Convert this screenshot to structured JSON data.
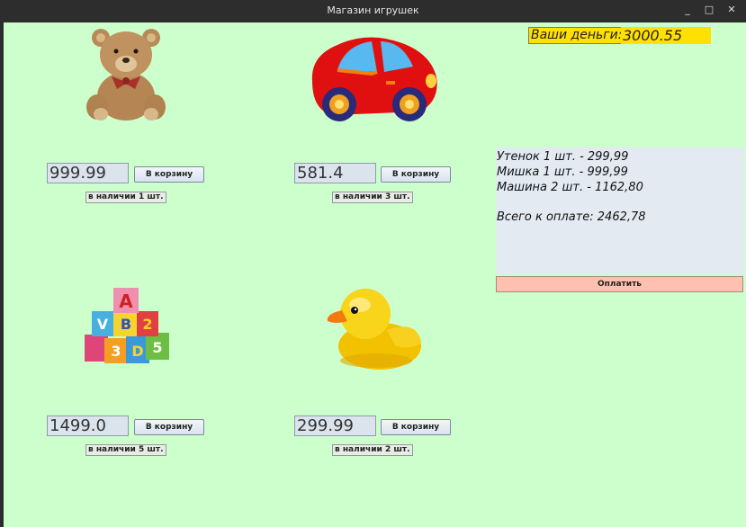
{
  "window": {
    "title": "Магазин игрушек",
    "minimize": "_",
    "maximize": "□",
    "close": "✕"
  },
  "wallet": {
    "label": "Ваши деньги:",
    "value": "3000.55"
  },
  "products": [
    {
      "icon": "teddy-bear-icon",
      "price": "999.99",
      "button": "В корзину",
      "stock": "в наличии 1 шт."
    },
    {
      "icon": "toy-car-icon",
      "price": "581.4",
      "button": "В корзину",
      "stock": "в наличии 3 шт."
    },
    {
      "icon": "toy-blocks-icon",
      "price": "1499.0",
      "button": "В корзину",
      "stock": "в наличии 5 шт."
    },
    {
      "icon": "rubber-duck-icon",
      "price": "299.99",
      "button": "В корзину",
      "stock": "в наличии 2 шт."
    }
  ],
  "cart": {
    "lines": [
      "Утенок 1 шт. - 299,99",
      "Мишка 1 шт. - 999,99",
      "Машина 2 шт. - 1162,80"
    ],
    "total": "Всего к оплате: 2462,78"
  },
  "pay_button": "Оплатить",
  "colors": {
    "background": "#ccffcc",
    "wallet": "#ffe000",
    "pay": "#ffc0b0",
    "cart": "#e3eaf1"
  }
}
